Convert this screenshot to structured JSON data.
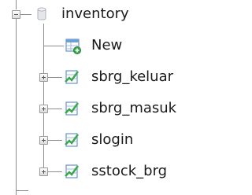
{
  "tree": {
    "database": {
      "label": "inventory",
      "icon": "database-icon",
      "expanded": true
    },
    "new_item": {
      "label": "New",
      "icon": "new-table-icon"
    },
    "tables": [
      {
        "label": "sbrg_keluar",
        "icon": "table-icon",
        "expanded": false
      },
      {
        "label": "sbrg_masuk",
        "icon": "table-icon",
        "expanded": false
      },
      {
        "label": "slogin",
        "icon": "table-icon",
        "expanded": false
      },
      {
        "label": "sstock_brg",
        "icon": "table-icon",
        "expanded": false
      }
    ]
  },
  "colors": {
    "line": "#8c8c8c",
    "table_icon_blue": "#4a7fc0",
    "table_icon_green": "#3aa84a",
    "database_icon": "#b8bcc4"
  }
}
